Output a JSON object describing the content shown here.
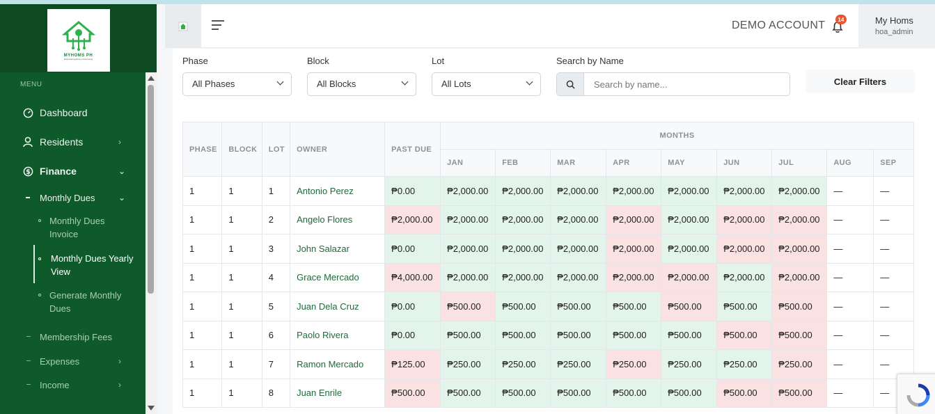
{
  "sidebar": {
    "logo": {
      "name": "MYHOMS PH",
      "tagline": "Empowering Every Community"
    },
    "menu_label": "MENU",
    "items": [
      {
        "label": "Dashboard"
      },
      {
        "label": "Residents"
      },
      {
        "label": "Finance"
      },
      {
        "label": "Monthly Dues"
      },
      {
        "label": "Membership Fees"
      },
      {
        "label": "Expenses"
      },
      {
        "label": "Income"
      }
    ],
    "subitems": [
      {
        "label": "Monthly Dues Invoice"
      },
      {
        "label": "Monthly Dues Yearly View"
      },
      {
        "label": "Generate Monthly Dues"
      }
    ]
  },
  "header": {
    "account": "DEMO ACCOUNT",
    "notifications": "14",
    "user_name": "My Homs",
    "user_role": "hoa_admin"
  },
  "filters": {
    "phase_label": "Phase",
    "phase_value": "All Phases",
    "block_label": "Block",
    "block_value": "All Blocks",
    "lot_label": "Lot",
    "lot_value": "All Lots",
    "search_label": "Search by Name",
    "search_placeholder": "Search by name...",
    "clear_label": "Clear Filters"
  },
  "table": {
    "headers": {
      "phase": "PHASE",
      "block": "BLOCK",
      "lot": "LOT",
      "owner": "OWNER",
      "past_due": "PAST DUE",
      "months": "MONTHS"
    },
    "months": [
      "JAN",
      "FEB",
      "MAR",
      "APR",
      "MAY",
      "JUN",
      "JUL",
      "AUG",
      "SEP"
    ],
    "rows": [
      {
        "phase": "1",
        "block": "1",
        "lot": "1",
        "owner": "Antonio Perez",
        "past_due": "₱0.00",
        "past_status": "g",
        "months": [
          "₱2,000.00",
          "₱2,000.00",
          "₱2,000.00",
          "₱2,000.00",
          "₱2,000.00",
          "₱2,000.00",
          "₱2,000.00",
          "—",
          "—"
        ],
        "status": [
          "g",
          "g",
          "g",
          "g",
          "g",
          "g",
          "g",
          "n",
          "n"
        ]
      },
      {
        "phase": "1",
        "block": "1",
        "lot": "2",
        "owner": "Angelo Flores",
        "past_due": "₱2,000.00",
        "past_status": "r",
        "months": [
          "₱2,000.00",
          "₱2,000.00",
          "₱2,000.00",
          "₱2,000.00",
          "₱2,000.00",
          "₱2,000.00",
          "₱2,000.00",
          "—",
          "—"
        ],
        "status": [
          "g",
          "g",
          "g",
          "r",
          "g",
          "r",
          "r",
          "n",
          "n"
        ]
      },
      {
        "phase": "1",
        "block": "1",
        "lot": "3",
        "owner": "John Salazar",
        "past_due": "₱0.00",
        "past_status": "g",
        "months": [
          "₱2,000.00",
          "₱2,000.00",
          "₱2,000.00",
          "₱2,000.00",
          "₱2,000.00",
          "₱2,000.00",
          "₱2,000.00",
          "—",
          "—"
        ],
        "status": [
          "g",
          "g",
          "g",
          "r",
          "g",
          "r",
          "r",
          "n",
          "n"
        ]
      },
      {
        "phase": "1",
        "block": "1",
        "lot": "4",
        "owner": "Grace Mercado",
        "past_due": "₱4,000.00",
        "past_status": "r",
        "months": [
          "₱2,000.00",
          "₱2,000.00",
          "₱2,000.00",
          "₱2,000.00",
          "₱2,000.00",
          "₱2,000.00",
          "₱2,000.00",
          "—",
          "—"
        ],
        "status": [
          "g",
          "g",
          "g",
          "r",
          "r",
          "g",
          "r",
          "n",
          "n"
        ]
      },
      {
        "phase": "1",
        "block": "1",
        "lot": "5",
        "owner": "Juan Dela Cruz",
        "past_due": "₱0.00",
        "past_status": "g",
        "months": [
          "₱500.00",
          "₱500.00",
          "₱500.00",
          "₱500.00",
          "₱500.00",
          "₱500.00",
          "₱500.00",
          "—",
          "—"
        ],
        "status": [
          "r",
          "g",
          "g",
          "g",
          "r",
          "g",
          "r",
          "n",
          "n"
        ]
      },
      {
        "phase": "1",
        "block": "1",
        "lot": "6",
        "owner": "Paolo Rivera",
        "past_due": "₱0.00",
        "past_status": "g",
        "months": [
          "₱500.00",
          "₱500.00",
          "₱500.00",
          "₱500.00",
          "₱500.00",
          "₱500.00",
          "₱500.00",
          "—",
          "—"
        ],
        "status": [
          "g",
          "g",
          "g",
          "g",
          "g",
          "r",
          "r",
          "n",
          "n"
        ]
      },
      {
        "phase": "1",
        "block": "1",
        "lot": "7",
        "owner": "Ramon Mercado",
        "past_due": "₱125.00",
        "past_status": "r",
        "months": [
          "₱250.00",
          "₱250.00",
          "₱250.00",
          "₱250.00",
          "₱250.00",
          "₱250.00",
          "₱250.00",
          "—",
          "—"
        ],
        "status": [
          "g",
          "g",
          "g",
          "r",
          "g",
          "g",
          "r",
          "n",
          "n"
        ]
      },
      {
        "phase": "1",
        "block": "1",
        "lot": "8",
        "owner": "Juan Enrile",
        "past_due": "₱500.00",
        "past_status": "r",
        "months": [
          "₱500.00",
          "₱500.00",
          "₱500.00",
          "₱500.00",
          "₱500.00",
          "₱500.00",
          "₱500.00",
          "—",
          "—"
        ],
        "status": [
          "g",
          "g",
          "g",
          "g",
          "g",
          "r",
          "r",
          "n",
          "n"
        ]
      }
    ]
  }
}
